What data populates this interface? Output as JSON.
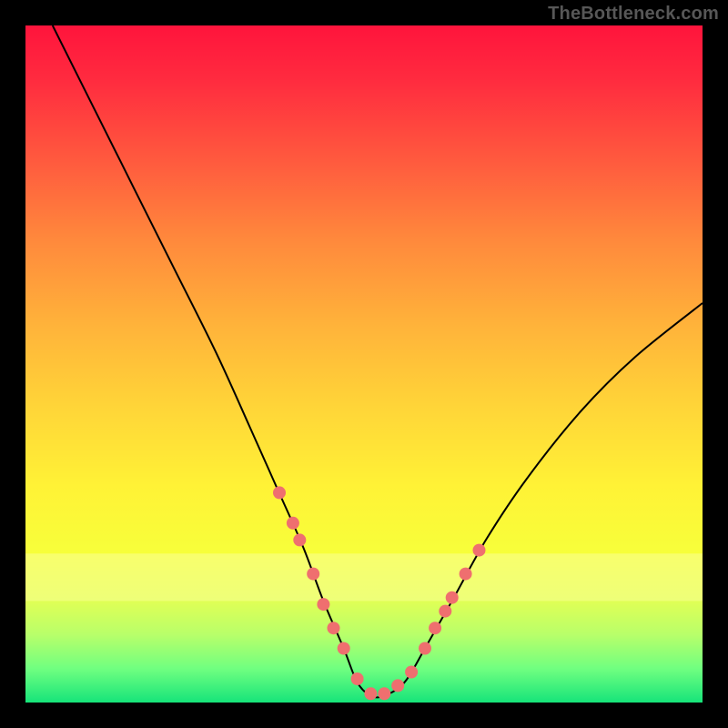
{
  "watermark": "TheBottleneck.com",
  "colors": {
    "page_bg": "#000000",
    "gradient_top": "#ff143c",
    "gradient_bottom": "#16e47a",
    "curve_stroke": "#000000",
    "marker_fill": "#ef6f6f",
    "highlight_band": "#faff96"
  },
  "chart_data": {
    "type": "line",
    "title": "",
    "xlabel": "",
    "ylabel": "",
    "xlim": [
      0,
      100
    ],
    "ylim": [
      0,
      100
    ],
    "grid": false,
    "legend": false,
    "annotations": [],
    "series": [
      {
        "name": "bottleneck-curve",
        "x": [
          4,
          10,
          16,
          22,
          28,
          33,
          37,
          41,
          44,
          47,
          49,
          51,
          53,
          56,
          59,
          63,
          68,
          74,
          82,
          90,
          100
        ],
        "values": [
          100,
          88,
          76,
          64,
          52,
          41,
          32,
          23,
          15,
          8,
          3,
          1,
          1,
          3,
          8,
          15,
          24,
          33,
          43,
          51,
          59
        ]
      }
    ],
    "markers": {
      "name": "highlighted-points",
      "x": [
        37.5,
        39.5,
        40.5,
        42.5,
        44.0,
        45.5,
        47.0,
        49.0,
        51.0,
        53.0,
        55.0,
        57.0,
        59.0,
        60.5,
        62.0,
        63.0,
        65.0,
        67.0
      ],
      "values": [
        31.0,
        26.5,
        24.0,
        19.0,
        14.5,
        11.0,
        8.0,
        3.5,
        1.3,
        1.3,
        2.5,
        4.5,
        8.0,
        11.0,
        13.5,
        15.5,
        19.0,
        22.5
      ]
    },
    "highlight_band_y": [
      15,
      22
    ]
  }
}
